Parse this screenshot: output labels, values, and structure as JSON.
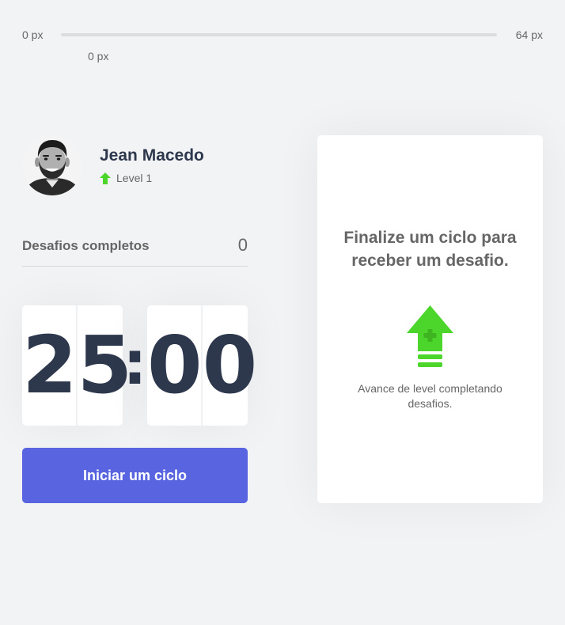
{
  "experience_bar": {
    "min_label": "0 px",
    "max_label": "64 px",
    "current_label": "0 px",
    "progress_fraction": 0,
    "fill_color": "#4cd62b"
  },
  "profile": {
    "name": "Jean Macedo",
    "level_label": "Level 1",
    "level_icon": "level-up-arrow-icon",
    "avatar": "avatar-photo"
  },
  "completed_challenges": {
    "label": "Desafios completos",
    "count": "0"
  },
  "countdown": {
    "minute_left": "2",
    "minute_right": "5",
    "separator": ":",
    "second_left": "0",
    "second_right": "0"
  },
  "start_cycle_button": {
    "label": "Iniciar um ciclo",
    "color": "#5965e0"
  },
  "challenge_box": {
    "title": "Finalize um ciclo para receber um desafio.",
    "icon": "level-up-icon",
    "hint": "Avance de level completando desafios."
  },
  "colors": {
    "background": "#f2f3f5",
    "title": "#2e384d",
    "text": "#666666",
    "green": "#4cd62b",
    "blue": "#5965e0"
  }
}
